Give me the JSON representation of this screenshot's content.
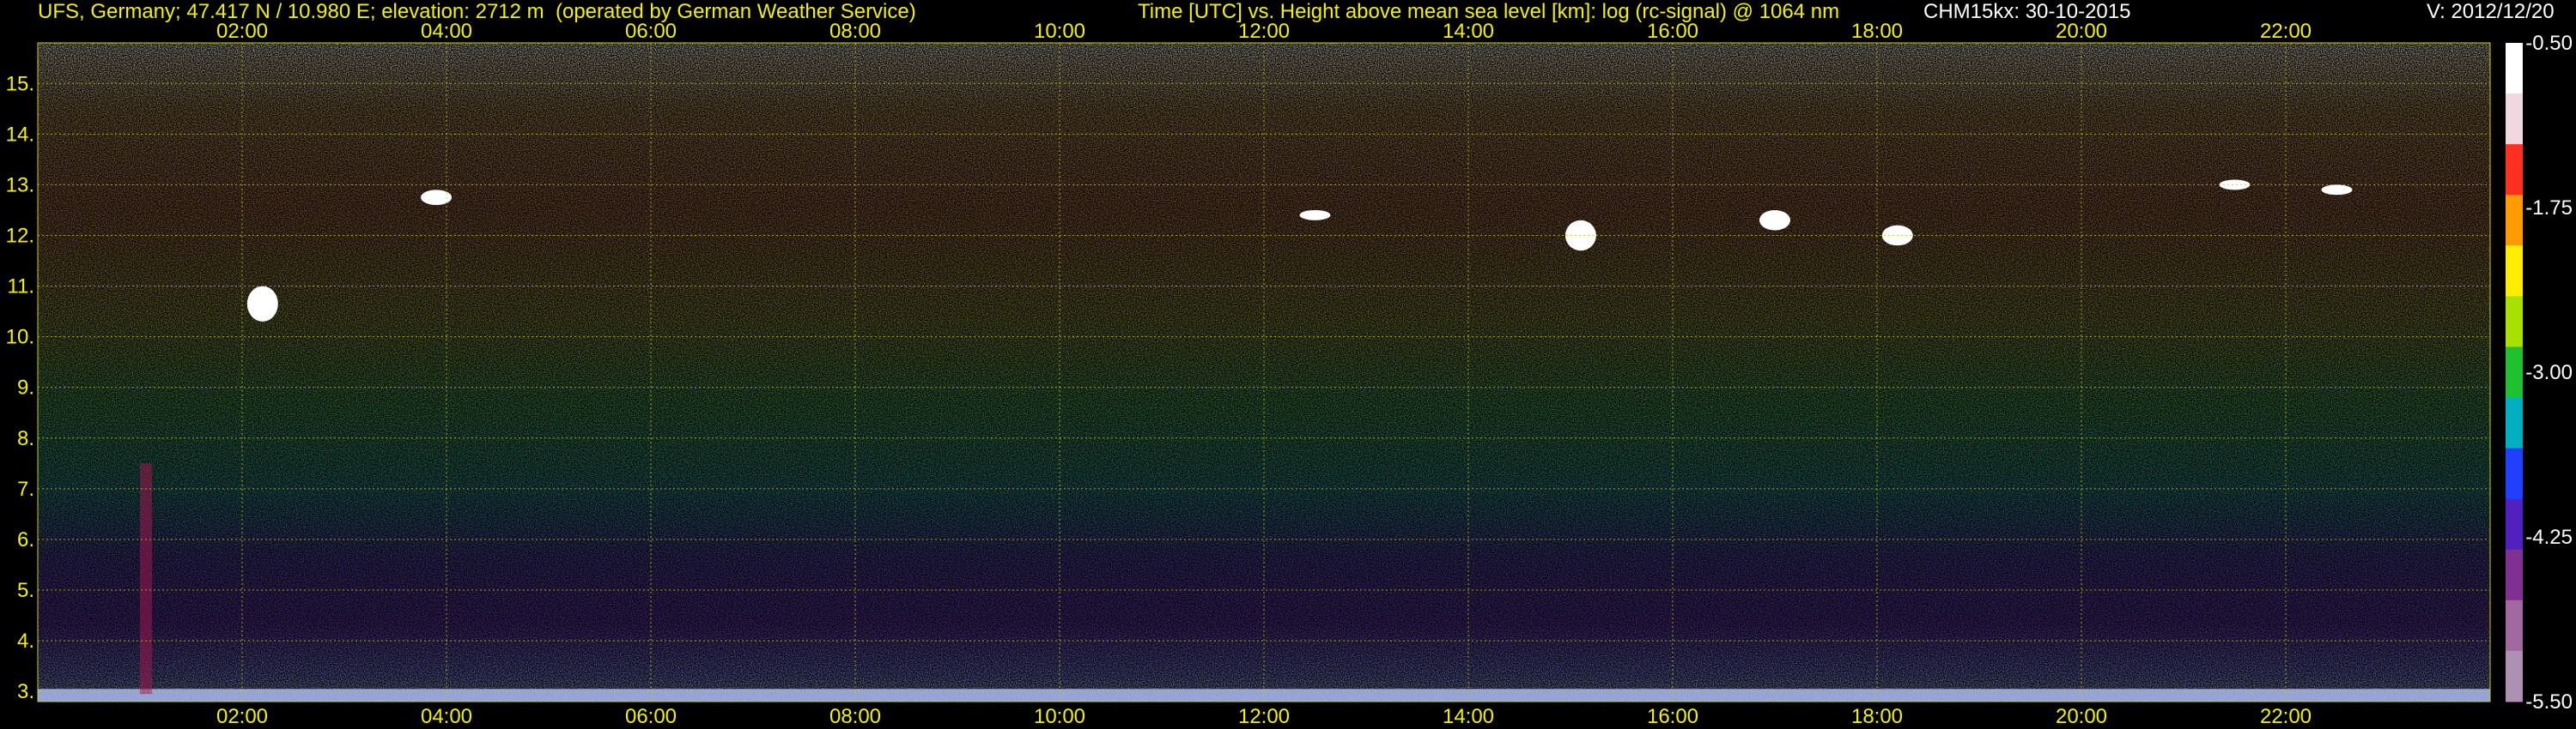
{
  "header": {
    "site": "UFS, Germany; 47.417 N / 10.980 E; elevation: 2712 m  (operated by German Weather Service)",
    "axes_title": "Time [UTC] vs. Height above mean sea level [km]: log (rc-signal) @ 1064 nm",
    "instrument_date": "CHM15kx: 30-10-2015",
    "version": "V: 2012/12/20"
  },
  "colors": {
    "background": "#000000",
    "label": "#f2f200",
    "white_text": "#ffffff",
    "grid": "#c8c800"
  },
  "chart_data": {
    "type": "heatmap",
    "title": "Time [UTC] vs. Height above mean sea level [km]: log (rc-signal) @ 1064 nm",
    "x_ticks": [
      "02:00",
      "04:00",
      "06:00",
      "08:00",
      "10:00",
      "12:00",
      "14:00",
      "16:00",
      "18:00",
      "20:00",
      "22:00"
    ],
    "x_tick_hours": [
      2,
      4,
      6,
      8,
      10,
      12,
      14,
      16,
      18,
      20,
      22
    ],
    "xlim_hours": [
      0,
      24
    ],
    "y_ticks": [
      "3.",
      "4.",
      "5.",
      "6.",
      "7.",
      "8.",
      "9.",
      "10.",
      "11.",
      "12.",
      "13.",
      "14.",
      "15."
    ],
    "y_tick_values": [
      3,
      4,
      5,
      6,
      7,
      8,
      9,
      10,
      11,
      12,
      13,
      14,
      15
    ],
    "ylim_km": [
      2.8,
      15.8
    ],
    "grid": true,
    "colorbar": {
      "ticks": [
        "-0.50",
        "-1.75",
        "-3.00",
        "-4.25",
        "-5.50"
      ],
      "tick_values": [
        -0.5,
        -1.75,
        -3.0,
        -4.25,
        -5.5
      ],
      "range": [
        -5.5,
        -0.5
      ],
      "colors": [
        "#ffffff",
        "#f0d8e0",
        "#ff3020",
        "#ff9a00",
        "#ffee00",
        "#a8e000",
        "#20c030",
        "#00b0c0",
        "#2040ff",
        "#5020c0",
        "#803090",
        "#a06aa0",
        "#b090b0"
      ]
    },
    "clouds": [
      {
        "hour": 2.2,
        "top_km": 11.0,
        "bottom_km": 10.3
      },
      {
        "hour": 3.9,
        "top_km": 12.9,
        "bottom_km": 12.6
      },
      {
        "hour": 12.5,
        "top_km": 12.5,
        "bottom_km": 12.3
      },
      {
        "hour": 15.1,
        "top_km": 12.3,
        "bottom_km": 11.7
      },
      {
        "hour": 17.0,
        "top_km": 12.5,
        "bottom_km": 12.1
      },
      {
        "hour": 18.2,
        "top_km": 12.2,
        "bottom_km": 11.8
      },
      {
        "hour": 21.5,
        "top_km": 13.1,
        "bottom_km": 12.9
      },
      {
        "hour": 22.5,
        "top_km": 13.0,
        "bottom_km": 12.8
      }
    ]
  }
}
